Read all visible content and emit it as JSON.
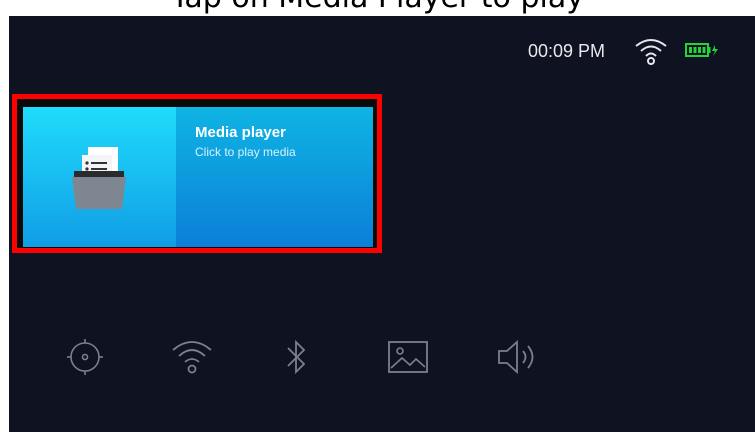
{
  "header_caption": "Tap on Media Player to play",
  "status": {
    "time": "00:09 PM",
    "wifi_icon": "wifi-icon",
    "battery_icon": "battery-charging-icon",
    "battery_color": "#22d33a"
  },
  "media_card": {
    "title": "Media player",
    "subtitle": "Click to play media",
    "icon": "folder-documents-icon",
    "highlight_color": "#ff0000"
  },
  "bottom_icons": [
    {
      "name": "crosshair-icon"
    },
    {
      "name": "wifi-icon"
    },
    {
      "name": "bluetooth-icon"
    },
    {
      "name": "image-icon"
    },
    {
      "name": "speaker-icon"
    }
  ]
}
